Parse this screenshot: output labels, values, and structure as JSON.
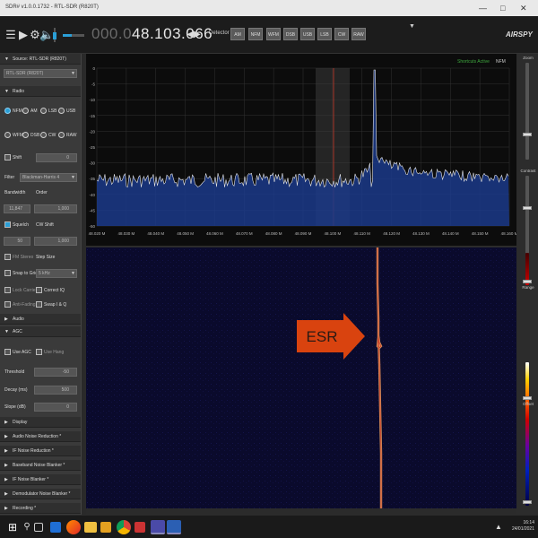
{
  "window": {
    "title": "SDR# v1.0.0.1732 - RTL-SDR (R820T)"
  },
  "toolbar": {
    "frequency_dim": "000.0",
    "frequency_main": "48.103.066",
    "detector_label": "Detector",
    "detector_modes": [
      "AM",
      "NFM",
      "WFM",
      "DSB",
      "USB",
      "LSB",
      "CW",
      "RAW"
    ],
    "brand": "AIRSPY"
  },
  "left_panel": {
    "source_section": "Source: RTL-SDR (R820T)",
    "source_value": "RTL-SDR (R820T)",
    "radio_section": "Radio",
    "radio_modes_row1": [
      "NFM",
      "AM",
      "LSB",
      "USB"
    ],
    "radio_modes_row2": [
      "WFM",
      "DSB",
      "CW",
      "RAW"
    ],
    "selected_mode": "NFM",
    "shift_label": "Shift",
    "shift_value": "0",
    "filter_label": "Filter",
    "filter_value": "Blackman-Harris 4",
    "bandwidth_label": "Bandwidth",
    "order_label": "Order",
    "bandwidth_value": "11,847",
    "order_value": "1,000",
    "squelch_label": "Squelch",
    "cw_shift_label": "CW Shift",
    "squelch_value": "50",
    "cw_shift_value": "1,000",
    "fm_stereo_label": "FM Stereo",
    "step_size_label": "Step Size",
    "snap_label": "Snap to Grid",
    "snap_value": "5 kHz",
    "lock_carrier_label": "Lock Carrier",
    "correct_iq_label": "Correct IQ",
    "anti_fading_label": "Anti-Fading",
    "swap_iq_label": "Swap I & Q",
    "audio_section": "Audio",
    "agc_section": "AGC",
    "use_agc_label": "Use AGC",
    "use_hang_label": "Use Hang",
    "threshold_label": "Threshold",
    "threshold_value": "-50",
    "decay_label": "Decay (ms)",
    "decay_value": "500",
    "slope_label": "Slope (dB)",
    "slope_value": "0",
    "collapsed_sections": [
      "Display",
      "Audio Noise Reduction *",
      "IF Noise Reduction *",
      "Baseband Noise Blanker *",
      "IF Noise Blanker *",
      "Demodulator Noise Blanker *",
      "Recording *"
    ]
  },
  "spectrum": {
    "shortcuts": "Shortcuts Active",
    "mode": "NFM",
    "y_ticks": [
      "0",
      "-5",
      "-10",
      "-15",
      "-20",
      "-25",
      "-30",
      "-35",
      "-40",
      "-45",
      "-50"
    ],
    "x_ticks": [
      "48.020 M",
      "48.030 M",
      "48.040 M",
      "48.050 M",
      "48.060 M",
      "48.070 M",
      "48.080 M",
      "48.090 M",
      "48.100 M",
      "48.110 M",
      "48.120 M",
      "48.130 M",
      "48.140 M",
      "48.150 M",
      "48.160 M"
    ]
  },
  "right_panel": {
    "zoom_label": "Zoom",
    "contrast_label": "Contrast",
    "range_label": "Range",
    "offset_label": "Offset"
  },
  "annotation": {
    "label": "ESR",
    "color": "#d9430f"
  },
  "taskbar": {
    "time": "16:14",
    "date": "24/01/2021"
  },
  "colors": {
    "spectrum_fill": "#1b3a8a",
    "trace": "#e6e6e6",
    "waterfall_bg": "#0a0a2c",
    "waterfall_line": "#e47a57",
    "accent": "#2a9fd6"
  }
}
